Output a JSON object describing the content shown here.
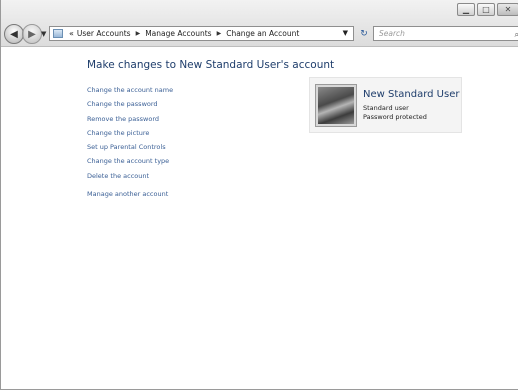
{
  "address_bar": {
    "prefix": "«",
    "crumbs": [
      "User Accounts",
      "Manage Accounts",
      "Change an Account"
    ]
  },
  "search": {
    "placeholder": "Search"
  },
  "page": {
    "heading": "Make changes to New Standard User's account",
    "tasks": [
      "Change the account name",
      "Change the password",
      "Remove the password",
      "Change the picture",
      "Set up Parental Controls",
      "Change the account type",
      "Delete the account"
    ],
    "manage_another": "Manage another account"
  },
  "account": {
    "name": "New Standard User",
    "type": "Standard user",
    "status": "Password protected"
  }
}
